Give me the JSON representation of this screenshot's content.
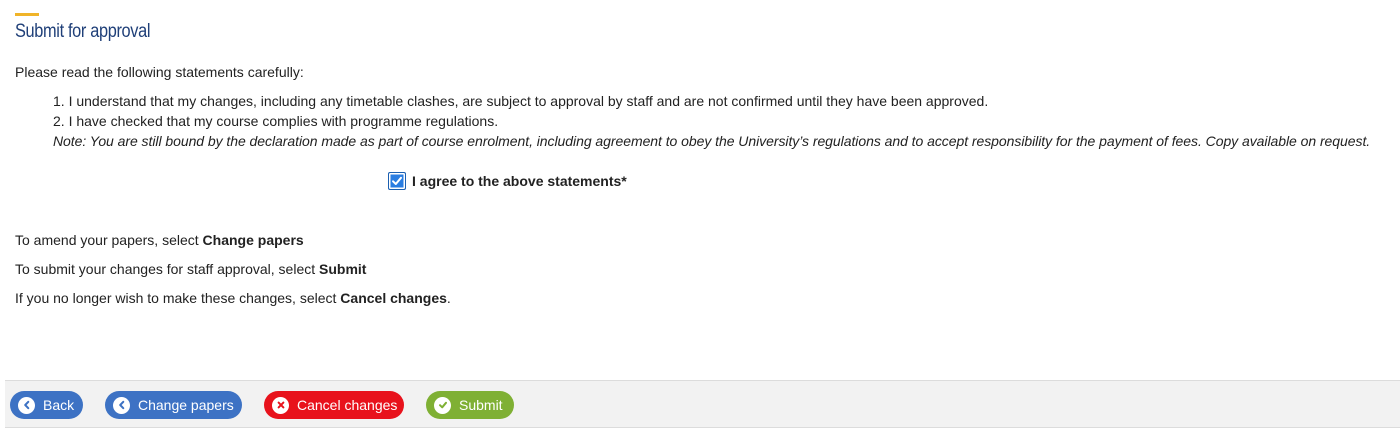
{
  "page": {
    "title": "Submit for approval",
    "intro": "Please read the following statements carefully:"
  },
  "statements": {
    "items": [
      "1. I understand that my changes, including any timetable clashes, are subject to approval by staff and are not confirmed until they have been approved.",
      "2. I have checked that my course complies with programme regulations."
    ],
    "note": "Note: You are still bound by the declaration made as part of course enrolment, including agreement to obey the University’s regulations and to accept responsibility for the payment of fees. Copy available on request."
  },
  "agreement": {
    "label": "I agree to the above statements*",
    "checked": true
  },
  "instructions": {
    "amend_prefix": "To amend your papers, select ",
    "amend_action": "Change papers",
    "submit_prefix": "To submit your changes for staff approval, select ",
    "submit_action": "Submit",
    "cancel_prefix": "If you no longer wish to make these changes, select ",
    "cancel_action": "Cancel changes",
    "cancel_suffix": "."
  },
  "footer": {
    "buttons": {
      "back": {
        "label": "Back",
        "icon": "chevron-left-icon",
        "color": "#3d72c4"
      },
      "change_papers": {
        "label": "Change papers",
        "icon": "chevron-left-icon",
        "color": "#3d72c4"
      },
      "cancel_changes": {
        "label": "Cancel changes",
        "icon": "x-circle-icon",
        "color": "#e8121c"
      },
      "submit": {
        "label": "Submit",
        "icon": "check-circle-icon",
        "color": "#7fb034"
      }
    }
  },
  "colors": {
    "title": "#1f3f78",
    "title_accent": "#f0b429",
    "checkbox": "#2a7de1"
  }
}
